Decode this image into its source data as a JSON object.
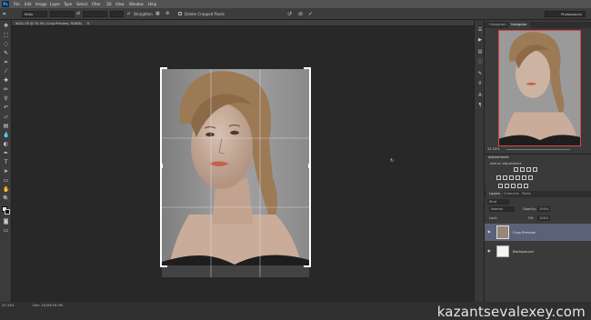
{
  "app": {
    "logo": "Ps"
  },
  "menu": [
    "File",
    "Edit",
    "Image",
    "Layer",
    "Type",
    "Select",
    "Filter",
    "3D",
    "View",
    "Window",
    "Help"
  ],
  "workspace": "Photography",
  "options": {
    "ratio_value": "Ratio",
    "straighten_label": "Straighten",
    "delete_cropped_label": "Delete Cropped Pixels",
    "delete_cropped_checked": true
  },
  "document": {
    "tab_title": "4001-F8 @ 33.3% (Crop Preview, RGB/8)"
  },
  "status": {
    "zoom": "33.33%",
    "doc_info": "Doc: 16.0M/16.0M"
  },
  "watermark": "kazantsevalexey.com",
  "navigator": {
    "tabs": [
      "Histogram",
      "Navigator"
    ],
    "active": "Navigator"
  },
  "adjustments": {
    "title": "Adjustments",
    "add_label": "Add an adjustment"
  },
  "layers_panel": {
    "tabs": [
      "Layers",
      "Channels",
      "Paths"
    ],
    "kind_label": "Kind",
    "blend_mode": "Normal",
    "opacity_label": "Opacity:",
    "opacity_value": "100%",
    "lock_label": "Lock:",
    "fill_label": "Fill:",
    "fill_value": "100%",
    "layers": [
      {
        "name": "Crop Preview",
        "selected": true
      },
      {
        "name": "Background",
        "selected": false
      }
    ]
  },
  "colors": {
    "selection": "#5a6178",
    "crop_handle": "#ffffff",
    "nav_box": "#e04545"
  }
}
